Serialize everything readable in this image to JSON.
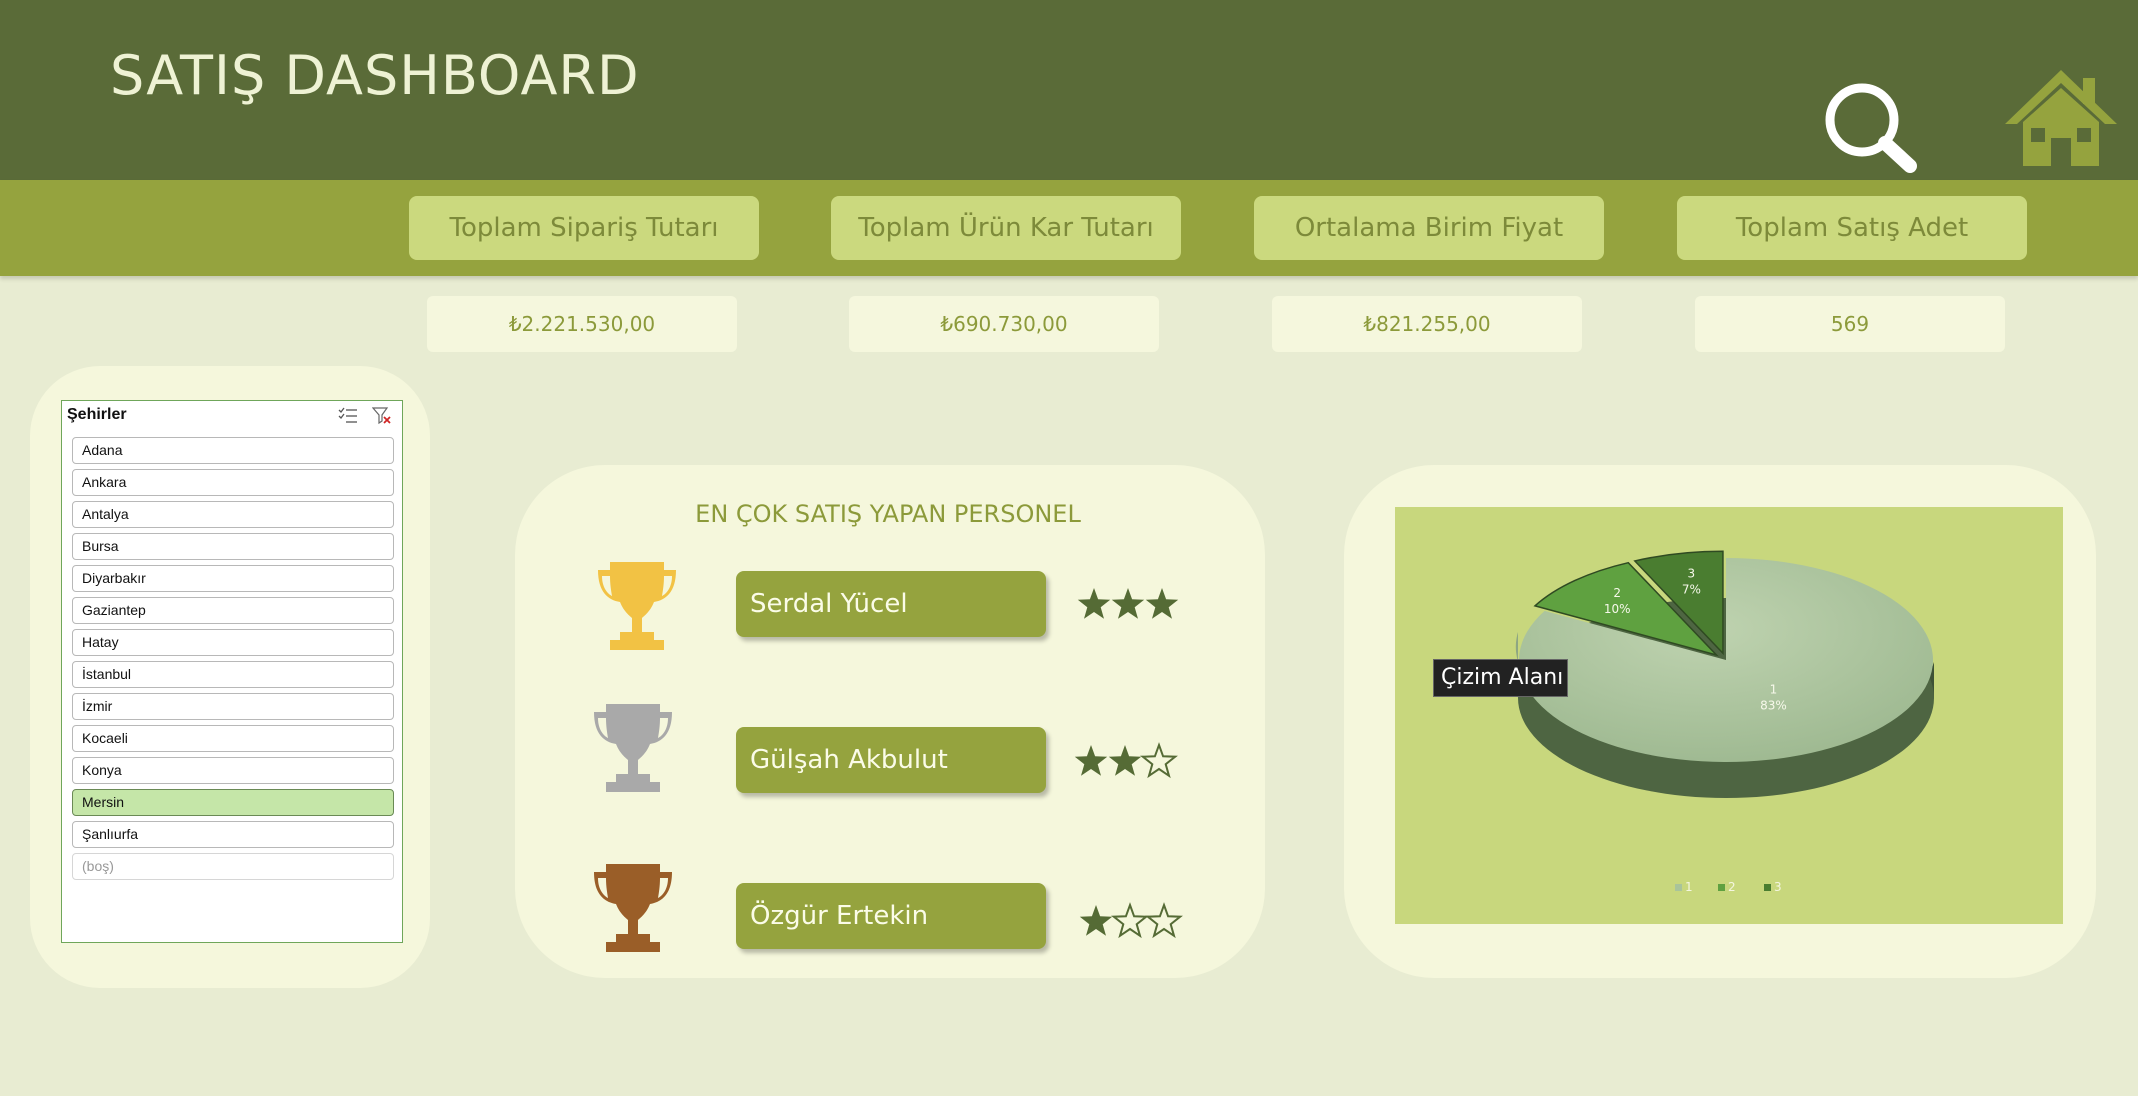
{
  "header": {
    "title": "SATIŞ DASHBOARD",
    "search_icon": "magnifier-icon",
    "home_icon": "house-icon"
  },
  "kpis": [
    {
      "label": "Toplam Sipariş Tutarı",
      "value": "₺2.221.530,00"
    },
    {
      "label": "Toplam Ürün Kar Tutarı",
      "value": "₺690.730,00"
    },
    {
      "label": "Ortalama Birim Fiyat",
      "value": "₺821.255,00"
    },
    {
      "label": "Toplam Satış Adet",
      "value": "569"
    }
  ],
  "slicer": {
    "title": "Şehirler",
    "items": [
      "Adana",
      "Ankara",
      "Antalya",
      "Bursa",
      "Diyarbakır",
      "Gaziantep",
      "Hatay",
      "İstanbul",
      "İzmir",
      "Kocaeli",
      "Konya",
      "Mersin",
      "Şanlıurfa",
      "(boş)"
    ],
    "selected": "Mersin"
  },
  "personnel": {
    "title": "EN ÇOK SATIŞ YAPAN PERSONEL",
    "people": [
      {
        "name": "Serdal Yücel",
        "stars": 3,
        "trophy": "gold-trophy-icon"
      },
      {
        "name": "Gülşah Akbulut",
        "stars": 2,
        "trophy": "silver-trophy-icon"
      },
      {
        "name": "Özgür Ertekin",
        "stars": 1,
        "trophy": "bronze-trophy-icon"
      }
    ],
    "max_stars": 3
  },
  "chart_data": {
    "type": "pie",
    "categories": [
      "1",
      "2",
      "3"
    ],
    "values": [
      83,
      10,
      7
    ],
    "data_labels": [
      "1\n83%",
      "2\n10%",
      "3\n7%"
    ],
    "legend": [
      "1",
      "2",
      "3"
    ],
    "legend_position": "bottom",
    "colors": [
      "#a9c49a",
      "#5fa140",
      "#4a7d30"
    ]
  },
  "tooltip": "Çizim Alanı",
  "colors": {
    "header": "#5a6b38",
    "subbar": "#95a33e",
    "kpi_label_bg": "#cbd97e",
    "kpi_value_bg": "#f5f7dd",
    "panel_bg": "#f5f7dc",
    "accent_text": "#8c9a3a",
    "star": "#556b35"
  }
}
